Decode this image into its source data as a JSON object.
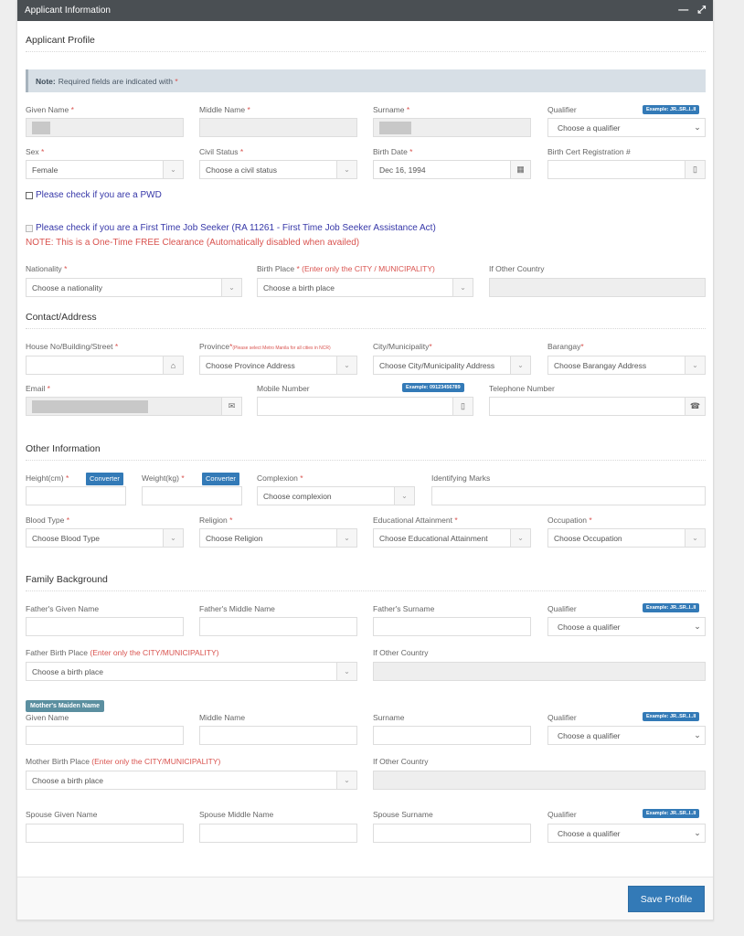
{
  "panel": {
    "title": "Applicant Information",
    "minimize_icon": "minus-icon",
    "expand_icon": "expand-icon"
  },
  "profile": {
    "section_title": "Applicant Profile",
    "note_bold": "Note:",
    "note_text": "Required fields are indicated with",
    "req_mark": "*",
    "given_name_label": "Given Name",
    "middle_name_label": "Middle Name",
    "surname_label": "Surname",
    "qualifier_label": "Qualifier",
    "qualifier_badge": "Example: JR..SR..I..II",
    "qualifier_placeholder": "Choose a qualifier",
    "sex_label": "Sex",
    "sex_value": "Female",
    "civil_status_label": "Civil Status",
    "civil_status_placeholder": "Choose a civil status",
    "birth_date_label": "Birth Date",
    "birth_date_value": "Dec 16, 1994",
    "birth_cert_label": "Birth Cert Registration #",
    "pwd_check_label": "Please check if you are a PWD",
    "ftjs_check_label": "Please check if you are a First Time Job Seeker (RA 11261 - First Time Job Seeker Assistance Act)",
    "ftjs_note": "NOTE: This is a One-Time FREE Clearance (Automatically disabled when availed)",
    "nationality_label": "Nationality",
    "nationality_placeholder": "Choose a nationality",
    "birth_place_label": "Birth Place",
    "birth_place_hint": "(Enter only the CITY / MUNICIPALITY)",
    "birth_place_placeholder": "Choose a birth place",
    "other_country_label": "If Other Country"
  },
  "contact": {
    "section_title": "Contact/Address",
    "house_label": "House No/Building/Street",
    "province_label": "Province",
    "province_hint": "(Please select Metro Manila for all cities in NCR)",
    "province_placeholder": "Choose Province Address",
    "city_label": "City/Municipality",
    "city_placeholder": "Choose City/Municipality Address",
    "barangay_label": "Barangay",
    "barangay_placeholder": "Choose Barangay Address",
    "email_label": "Email",
    "mobile_label": "Mobile Number",
    "mobile_badge": "Example: 09123456789",
    "telephone_label": "Telephone Number"
  },
  "other": {
    "section_title": "Other Information",
    "height_label": "Height(cm)",
    "weight_label": "Weight(kg)",
    "converter_label": "Converter",
    "complexion_label": "Complexion",
    "complexion_placeholder": "Choose complexion",
    "marks_label": "Identifying Marks",
    "blood_label": "Blood Type",
    "blood_placeholder": "Choose Blood Type",
    "religion_label": "Religion",
    "religion_placeholder": "Choose Religion",
    "education_label": "Educational Attainment",
    "education_placeholder": "Choose Educational Attainment",
    "occupation_label": "Occupation",
    "occupation_placeholder": "Choose Occupation"
  },
  "family": {
    "section_title": "Family Background",
    "father_given_label": "Father's Given Name",
    "father_middle_label": "Father's Middle Name",
    "father_surname_label": "Father's Surname",
    "qualifier_label": "Qualifier",
    "qualifier_badge": "Example: JR..SR..I..II",
    "qualifier_placeholder": "Choose a qualifier",
    "father_birth_label": "Father Birth Place",
    "birth_hint": "(Enter only the CITY/MUNICIPALITY)",
    "birth_placeholder": "Choose a birth place",
    "other_country_label": "If Other Country",
    "mother_tag": "Mother's Maiden Name",
    "mother_given_label": "Given Name",
    "mother_middle_label": "Middle Name",
    "mother_surname_label": "Surname",
    "mother_birth_label": "Mother Birth Place",
    "spouse_given_label": "Spouse Given Name",
    "spouse_middle_label": "Spouse Middle Name",
    "spouse_surname_label": "Spouse Surname"
  },
  "footer": {
    "save_label": "Save Profile"
  },
  "colors": {
    "header_bg": "#4a4f53",
    "primary": "#337ab7",
    "required": "#d9534f",
    "checkbox_label": "#3637a8",
    "note_bg": "#d7dfe6"
  }
}
